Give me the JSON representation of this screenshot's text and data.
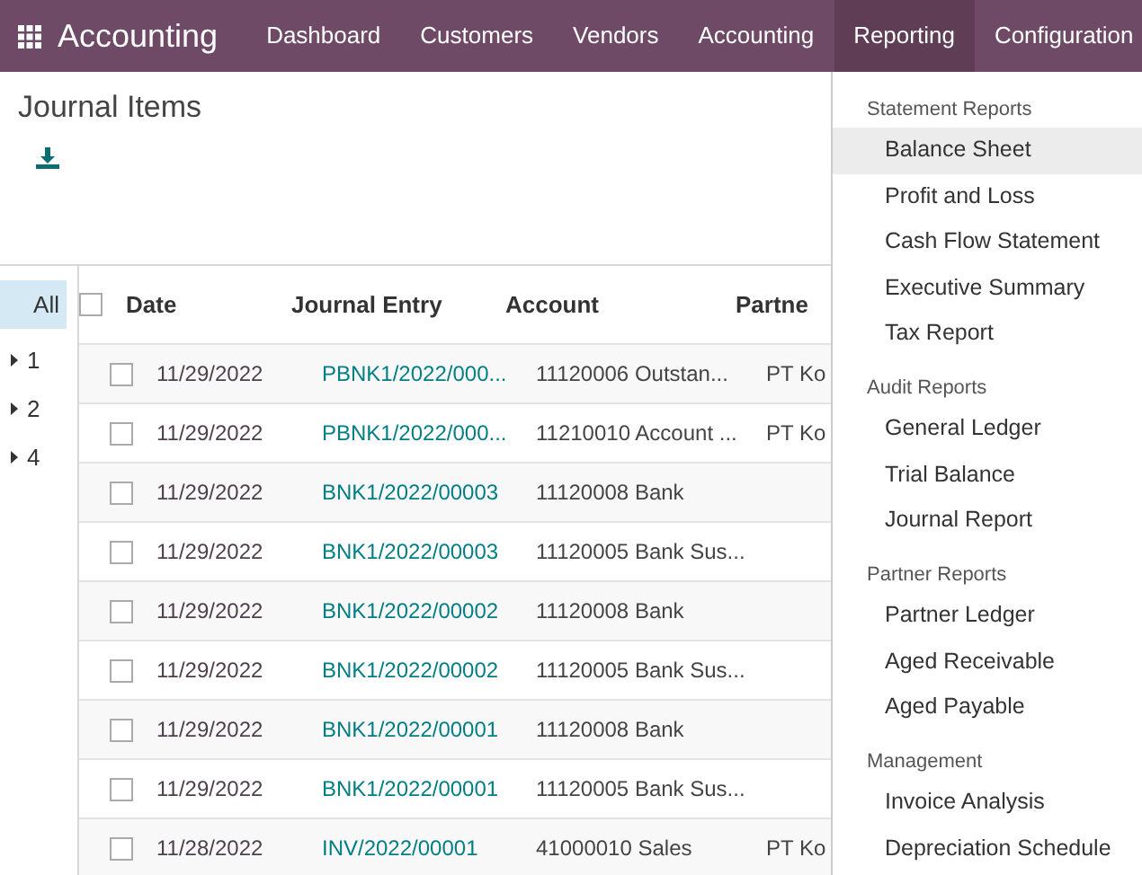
{
  "navbar": {
    "app_name": "Accounting",
    "items": [
      {
        "label": "Dashboard",
        "selected": false
      },
      {
        "label": "Customers",
        "selected": false
      },
      {
        "label": "Vendors",
        "selected": false
      },
      {
        "label": "Accounting",
        "selected": false
      },
      {
        "label": "Reporting",
        "selected": true
      },
      {
        "label": "Configuration",
        "selected": false
      }
    ]
  },
  "page": {
    "title": "Journal Items"
  },
  "side_panel": {
    "items": [
      {
        "label": "All",
        "selected": true,
        "expandable": false
      },
      {
        "label": "1",
        "selected": false,
        "expandable": true
      },
      {
        "label": "2",
        "selected": false,
        "expandable": true
      },
      {
        "label": "4",
        "selected": false,
        "expandable": true
      }
    ]
  },
  "table": {
    "all_selected": false,
    "columns": [
      "Date",
      "Journal Entry",
      "Account",
      "Partne"
    ],
    "rows": [
      {
        "date": "11/29/2022",
        "journal_entry": "PBNK1/2022/000...",
        "account": "11120006 Outstan...",
        "partner": "PT Ko",
        "checked": false
      },
      {
        "date": "11/29/2022",
        "journal_entry": "PBNK1/2022/000...",
        "account": "11210010 Account ...",
        "partner": "PT Ko",
        "checked": false
      },
      {
        "date": "11/29/2022",
        "journal_entry": "BNK1/2022/00003",
        "account": "11120008 Bank",
        "checked": false
      },
      {
        "date": "11/29/2022",
        "journal_entry": "BNK1/2022/00003",
        "account": "11120005 Bank Sus...",
        "checked": false
      },
      {
        "date": "11/29/2022",
        "journal_entry": "BNK1/2022/00002",
        "account": "11120008 Bank",
        "checked": false
      },
      {
        "date": "11/29/2022",
        "journal_entry": "BNK1/2022/00002",
        "account": "11120005 Bank Sus...",
        "checked": false
      },
      {
        "date": "11/29/2022",
        "journal_entry": "BNK1/2022/00001",
        "account": "11120008 Bank",
        "checked": false
      },
      {
        "date": "11/29/2022",
        "journal_entry": "BNK1/2022/00001",
        "account": "11120005 Bank Sus...",
        "checked": false
      },
      {
        "date": "11/28/2022",
        "journal_entry": "INV/2022/00001",
        "account": "41000010 Sales",
        "partner": "PT Ko",
        "checked": false
      }
    ]
  },
  "menu": {
    "sections": [
      {
        "title": "Statement Reports",
        "items": [
          {
            "label": "Balance Sheet",
            "selected": true
          },
          {
            "label": "Profit and Loss",
            "selected": false
          },
          {
            "label": "Cash Flow Statement",
            "selected": false
          },
          {
            "label": "Executive Summary",
            "selected": false
          },
          {
            "label": "Tax Report",
            "selected": false
          }
        ]
      },
      {
        "title": "Audit Reports",
        "items": [
          {
            "label": "General Ledger",
            "selected": false
          },
          {
            "label": "Trial Balance",
            "selected": false
          },
          {
            "label": "Journal Report",
            "selected": false
          }
        ]
      },
      {
        "title": "Partner Reports",
        "items": [
          {
            "label": "Partner Ledger",
            "selected": false
          },
          {
            "label": "Aged Receivable",
            "selected": false
          },
          {
            "label": "Aged Payable",
            "selected": false
          }
        ]
      },
      {
        "title": "Management",
        "items": [
          {
            "label": "Invoice Analysis",
            "selected": false
          },
          {
            "label": "Depreciation Schedule",
            "selected": false
          }
        ]
      }
    ]
  }
}
